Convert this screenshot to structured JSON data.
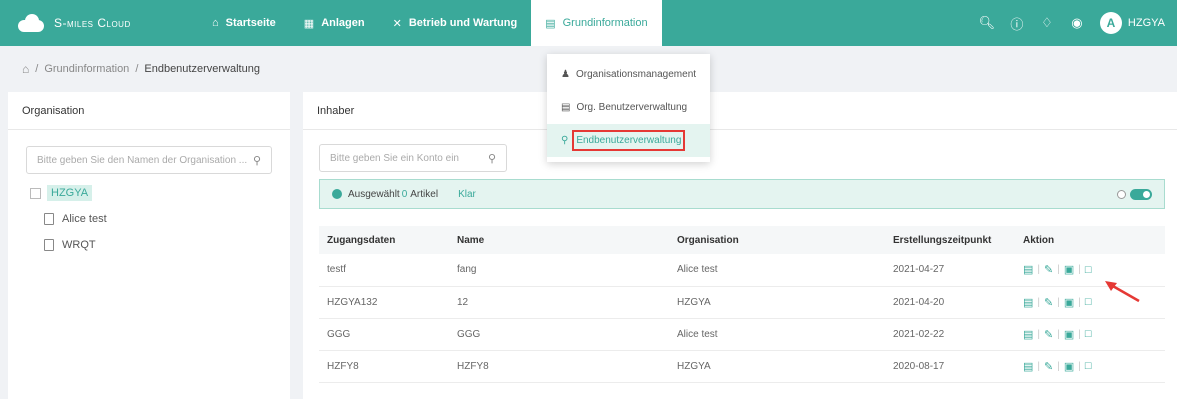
{
  "brand": {
    "name": "S-miles Cloud"
  },
  "nav": [
    {
      "label": "Startseite",
      "icon": "home-icon",
      "glyph": "⌂"
    },
    {
      "label": "Anlagen",
      "icon": "grid-icon",
      "glyph": "▦"
    },
    {
      "label": "Betrieb und Wartung",
      "icon": "tools-icon",
      "glyph": "✕"
    },
    {
      "label": "Grundinformation",
      "icon": "document-icon",
      "glyph": "▤",
      "active": true
    }
  ],
  "topRight": {
    "icons": [
      "search-icon",
      "help-icon",
      "bell-icon",
      "globe-icon"
    ],
    "avatarInitial": "A",
    "userName": "HZGYA"
  },
  "breadcrumb": {
    "root": "Grundinformation",
    "separator": "/",
    "current": "Endbenutzerverwaltung"
  },
  "leftPanel": {
    "title": "Organisation",
    "searchPlaceholder": "Bitte geben Sie den Namen der Organisation ...",
    "tree": {
      "root": "HZGYA",
      "children": [
        "Alice test",
        "WRQT"
      ]
    }
  },
  "rightPanel": {
    "title": "Inhaber",
    "searchPlaceholder": "Bitte geben Sie ein Konto ein",
    "selection": {
      "prefix": "Ausgewählt",
      "count": "0",
      "suffix": "Artikel",
      "clear": "Klar"
    },
    "columns": [
      "Zugangsdaten",
      "Name",
      "Organisation",
      "Erstellungszeitpunkt",
      "Aktion"
    ],
    "rows": [
      {
        "account": "testf",
        "name": "fang",
        "org": "Alice test",
        "created": "2021-04-27"
      },
      {
        "account": "HZGYA132",
        "name": "12",
        "org": "HZGYA",
        "created": "2021-04-20"
      },
      {
        "account": "GGG",
        "name": "GGG",
        "org": "Alice test",
        "created": "2021-02-22"
      },
      {
        "account": "HZFY8",
        "name": "HZFY8",
        "org": "HZGYA",
        "created": "2020-08-17"
      }
    ]
  },
  "dropdown": [
    {
      "label": "Organisationsmanagement",
      "icon": "users-icon"
    },
    {
      "label": "Org. Benutzerverwaltung",
      "icon": "id-card-icon"
    },
    {
      "label": "Endbenutzerverwaltung",
      "icon": "user-icon",
      "active": true
    }
  ],
  "colors": {
    "primary": "#3aa99a",
    "highlight": "#e53935",
    "selectionBg": "#e4f4f0"
  }
}
